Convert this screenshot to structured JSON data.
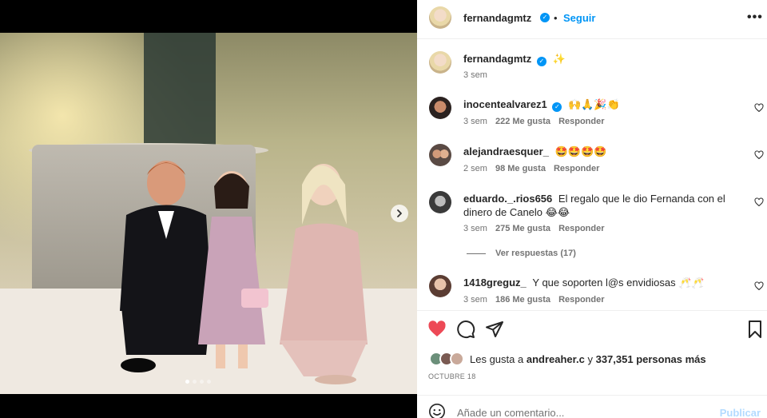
{
  "post": {
    "author": "fernandagmtz",
    "follow_label": "Seguir",
    "separator": "•",
    "more_label": "•••",
    "caption": "✨",
    "caption_time": "3 sem"
  },
  "comments": [
    {
      "user": "inocentealvarez1",
      "verified": true,
      "text": "🙌🙏🎉👏",
      "time": "3 sem",
      "likes": "222 Me gusta",
      "reply": "Responder"
    },
    {
      "user": "alejandraesquer_",
      "verified": false,
      "text": "🤩🤩🤩🤩",
      "time": "2 sem",
      "likes": "98 Me gusta",
      "reply": "Responder"
    },
    {
      "user": "eduardo._.rios656",
      "verified": false,
      "text": "El regalo que le dio Fernanda con el dinero de Canelo 😂😂",
      "time": "3 sem",
      "likes": "275 Me gusta",
      "reply": "Responder",
      "view_replies": "Ver respuestas (17)"
    },
    {
      "user": "1418greguz_",
      "verified": false,
      "text": "Y que soporten l@s envidiosas 🥂🥂",
      "time": "3 sem",
      "likes": "186 Me gusta",
      "reply": "Responder"
    }
  ],
  "likes": {
    "prefix": "Les gusta a",
    "user": "andreaher.c",
    "connector": "y",
    "count": "337,351 personas más"
  },
  "date": "OCTUBRE 18",
  "add_comment": {
    "placeholder": "Añade un comentario...",
    "publish": "Publicar"
  },
  "carousel": {
    "count": 4,
    "active": 1
  },
  "colors": {
    "like_red": "#ed4956",
    "link_blue": "#0095f6",
    "publish_disabled": "#b3dbff"
  }
}
